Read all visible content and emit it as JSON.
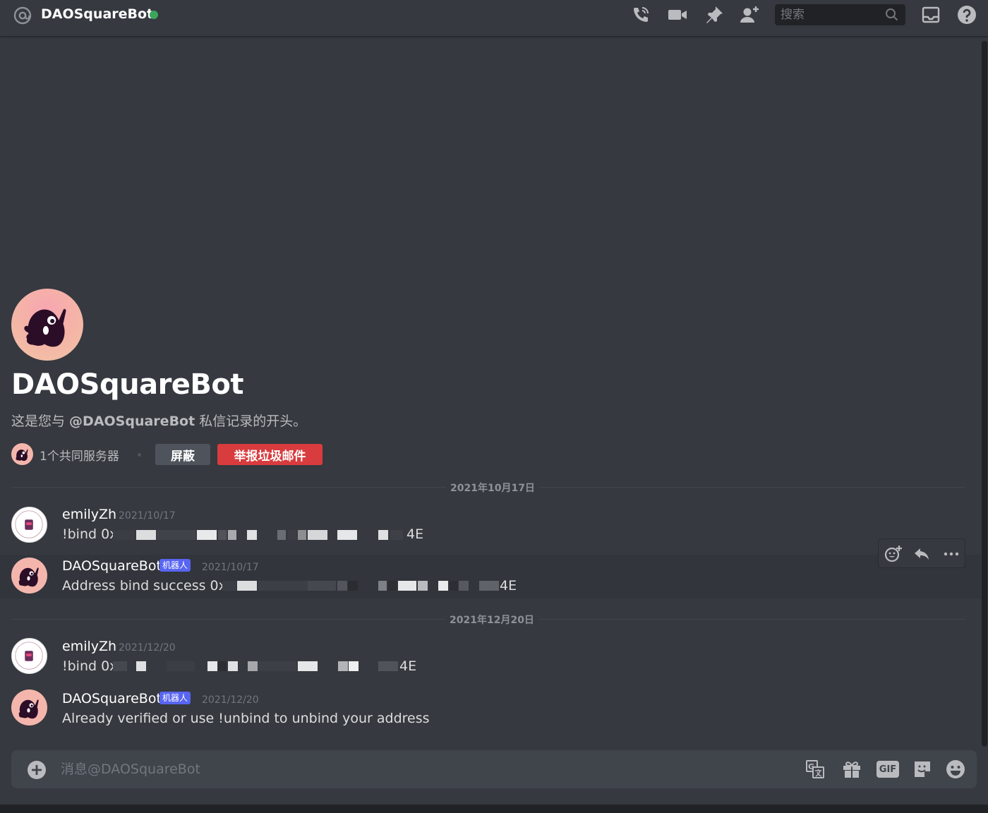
{
  "header": {
    "title": "DAOSquareBot",
    "search_placeholder": "搜索",
    "status_color": "#3ba55c",
    "icons": [
      "at-icon",
      "phone-call-icon",
      "video-call-icon",
      "pin-icon",
      "add-friend-icon",
      "search-icon",
      "inbox-icon",
      "help-icon"
    ]
  },
  "welcome": {
    "title": "DAOSquareBot",
    "subtitle_prefix": "这是您与 ",
    "subtitle_mention": "@DAOSquareBot",
    "subtitle_suffix": " 私信记录的开头。",
    "mutual_servers": "1个共同服务器",
    "block_label": "屏蔽",
    "report_label": "举报垃圾邮件"
  },
  "dates": [
    "2021年10月17日",
    "2021年12月20日"
  ],
  "messages": [
    {
      "author": "emilyZh",
      "bot": false,
      "time": "2021/10/17",
      "text_start": "!bind 0x",
      "text_end": "4E"
    },
    {
      "author": "DAOSquareBot",
      "bot": true,
      "bot_tag": "机器人",
      "time": "2021/10/17",
      "text_start": "Address bind success 0xc",
      "text_end": "4E"
    },
    {
      "author": "emilyZh",
      "bot": false,
      "time": "2021/12/20",
      "text_start": "!bind 0x",
      "text_end": "4E"
    },
    {
      "author": "DAOSquareBot",
      "bot": true,
      "bot_tag": "机器人",
      "time": "2021/12/20",
      "text_start": "Already verified or use !unbind to unbind your address",
      "text_end": ""
    }
  ],
  "message_actions": [
    "add-reaction-icon",
    "reply-icon",
    "more-icon"
  ],
  "composer": {
    "placeholder": "消息@DAOSquareBot",
    "icons": [
      "add-attachment-icon",
      "translate-icon",
      "gift-icon",
      "gif-icon",
      "sticker-icon",
      "emoji-icon"
    ],
    "gif_label": "GIF"
  },
  "colors": {
    "accent": "#5865f2",
    "danger": "#d83c3e",
    "online": "#3ba55c",
    "background": "#36393f"
  }
}
